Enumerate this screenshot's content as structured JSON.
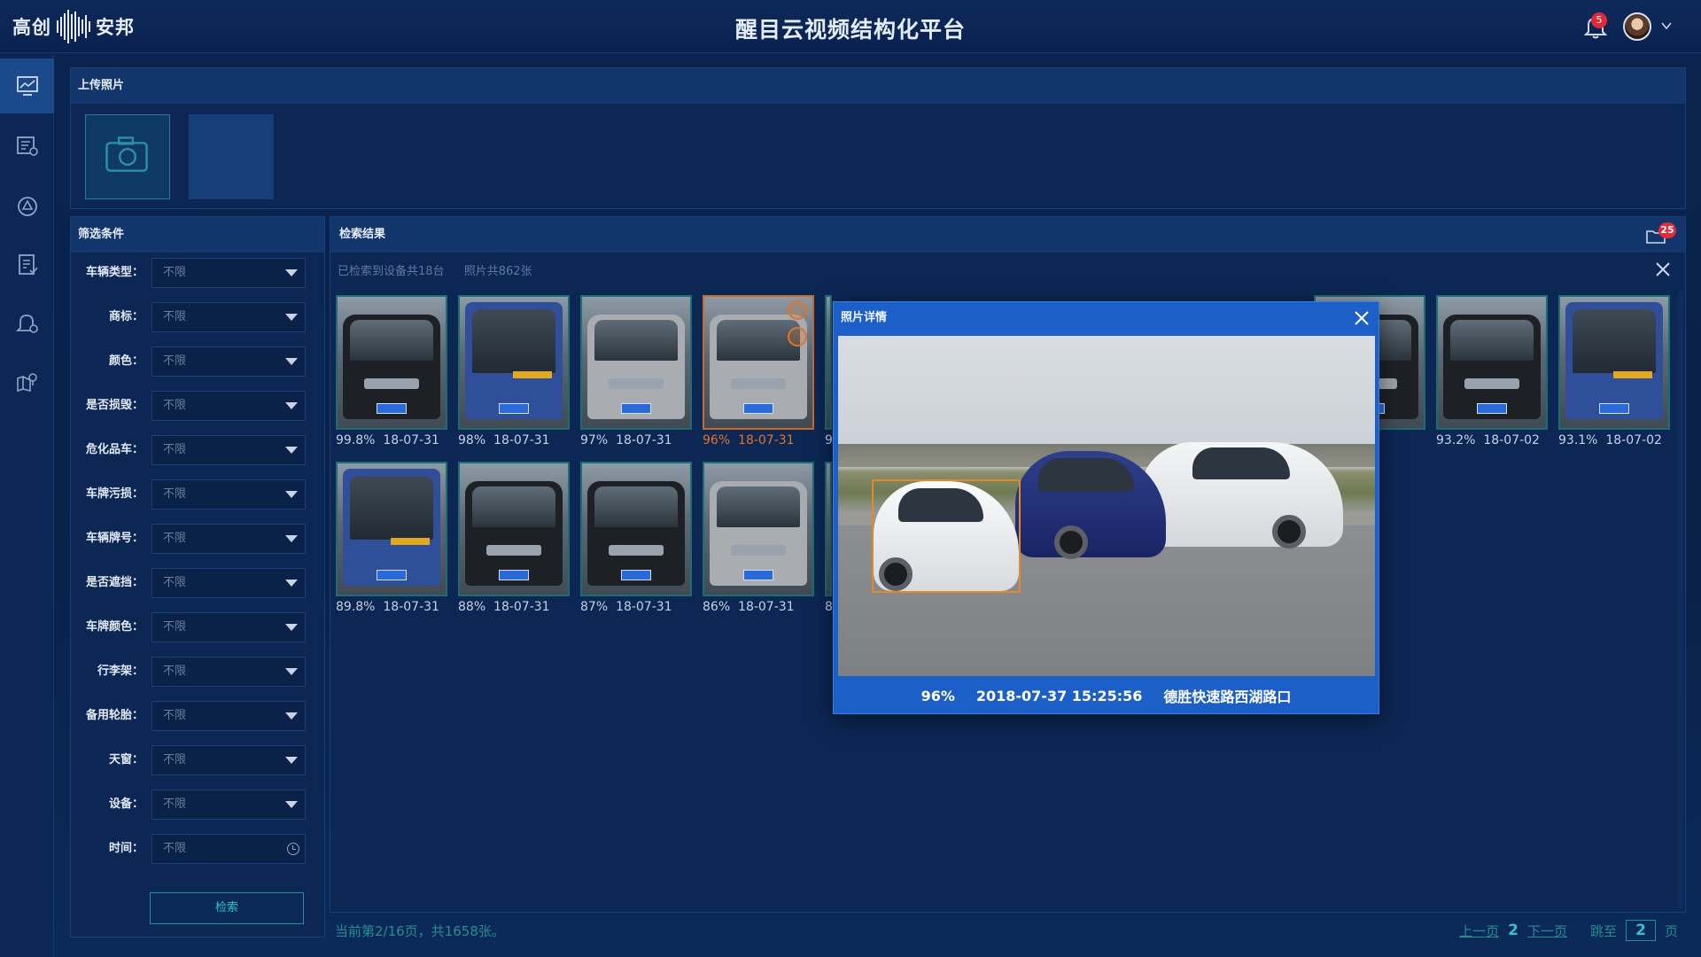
{
  "header": {
    "logo_text_left": "高创",
    "logo_text_right": "安邦",
    "title": "醒目云视频结构化平台",
    "notification_count": "5"
  },
  "upload": {
    "title": "上传照片"
  },
  "filters": {
    "title": "筛选条件",
    "rows": [
      {
        "label": "车辆类型：",
        "value": "不限"
      },
      {
        "label": "商标：",
        "value": "不限"
      },
      {
        "label": "颜色：",
        "value": "不限"
      },
      {
        "label": "是否损毁：",
        "value": "不限"
      },
      {
        "label": "危化品车：",
        "value": "不限"
      },
      {
        "label": "车牌污损：",
        "value": "不限"
      },
      {
        "label": "车辆牌号：",
        "value": "不限"
      },
      {
        "label": "是否遮挡：",
        "value": "不限"
      },
      {
        "label": "车牌颜色：",
        "value": "不限"
      },
      {
        "label": "行李架：",
        "value": "不限"
      },
      {
        "label": "备用轮胎：",
        "value": "不限"
      },
      {
        "label": "天窗：",
        "value": "不限"
      },
      {
        "label": "设备：",
        "value": "不限"
      },
      {
        "label": "时间：",
        "value": "不限"
      }
    ],
    "search_label": "检索"
  },
  "results": {
    "title": "检索结果",
    "folder_count": "25",
    "summary_devices": "已检索到设备共18台",
    "summary_photos": "照片共862张",
    "row1": [
      {
        "score": "99.8%",
        "date": "18-07-31",
        "kind": "sedan-dark"
      },
      {
        "score": "98%",
        "date": "18-07-31",
        "kind": "bus"
      },
      {
        "score": "97%",
        "date": "18-07-31",
        "kind": "sedan-silver"
      },
      {
        "score": "96%",
        "date": "18-07-31",
        "kind": "sedan-silver",
        "highlight": true
      },
      {
        "score": "9",
        "date": "",
        "kind": "partial"
      },
      {
        "score": "",
        "date": "",
        "kind": "hidden"
      },
      {
        "score": "",
        "date": "",
        "kind": "hidden"
      },
      {
        "score": "",
        "date": "",
        "kind": "hidden"
      },
      {
        "score": "",
        "date": "7-03",
        "kind": "sedan-dark"
      },
      {
        "score": "93.2%",
        "date": "18-07-02",
        "kind": "sedan-dark"
      },
      {
        "score": "93.1%",
        "date": "18-07-02",
        "kind": "bus"
      }
    ],
    "row2": [
      {
        "score": "89.8%",
        "date": "18-07-31",
        "kind": "bus"
      },
      {
        "score": "88%",
        "date": "18-07-31",
        "kind": "sedan-dark"
      },
      {
        "score": "87%",
        "date": "18-07-31",
        "kind": "sedan-dark"
      },
      {
        "score": "86%",
        "date": "18-07-31",
        "kind": "sedan-silver"
      },
      {
        "score": "8",
        "date": "",
        "kind": "partial"
      }
    ]
  },
  "pager": {
    "info": "当前第2/16页，共1658张。",
    "prev": "上一页",
    "current": "2",
    "next": "下一页",
    "jump_label": "跳至",
    "jump_value": "2",
    "page_suffix": "页"
  },
  "modal": {
    "title": "照片详情",
    "score": "96%",
    "timestamp": "2018-07-37 15:25:56",
    "location": "德胜快速路西湖路口"
  },
  "colors": {
    "accent_teal": "#2fc4c6",
    "highlight_orange": "#e0752c",
    "badge_red": "#e02a3a",
    "modal_blue": "#1c5fc8"
  }
}
